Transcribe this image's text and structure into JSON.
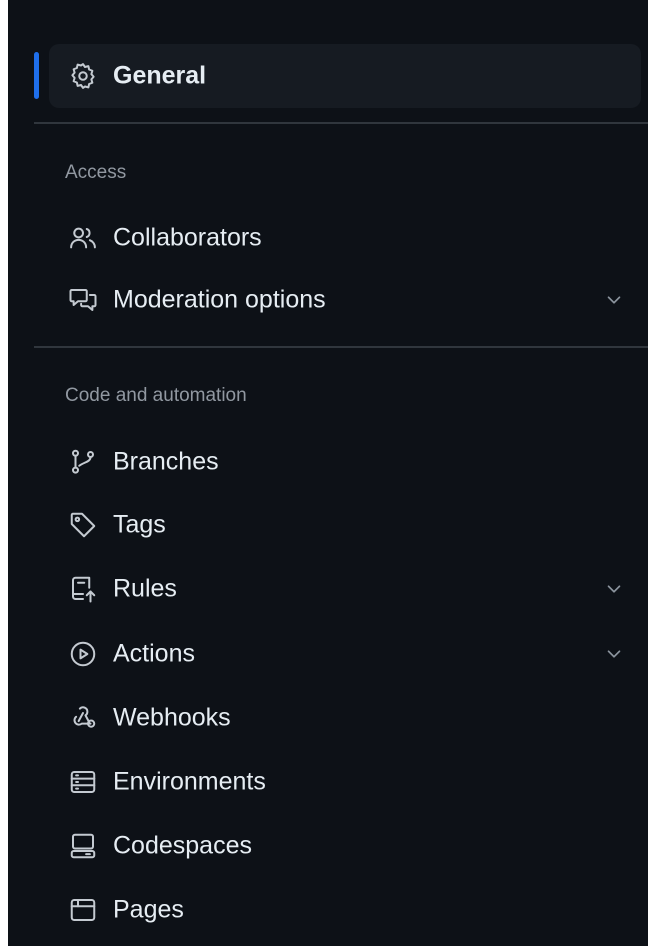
{
  "sidebar": {
    "general": {
      "label": "General",
      "icon": "gear-icon"
    },
    "sections": [
      {
        "title": "Access",
        "items": [
          {
            "label": "Collaborators",
            "icon": "people-icon"
          },
          {
            "label": "Moderation options",
            "icon": "comment-discussion-icon"
          }
        ]
      },
      {
        "title": "Code and automation",
        "items": [
          {
            "label": "Branches",
            "icon": "git-branch-icon"
          },
          {
            "label": "Tags",
            "icon": "tag-icon"
          },
          {
            "label": "Rules",
            "icon": "repo-push-icon"
          },
          {
            "label": "Actions",
            "icon": "play-icon"
          },
          {
            "label": "Webhooks",
            "icon": "webhook-icon"
          },
          {
            "label": "Environments",
            "icon": "server-icon"
          },
          {
            "label": "Codespaces",
            "icon": "codespaces-icon"
          },
          {
            "label": "Pages",
            "icon": "browser-icon"
          }
        ]
      }
    ]
  },
  "colors": {
    "background": "#0d1117",
    "active_background": "#161b22",
    "accent": "#1f6feb",
    "text": "#e6edf3",
    "muted_text": "#9198a1",
    "divider": "#30363d"
  }
}
